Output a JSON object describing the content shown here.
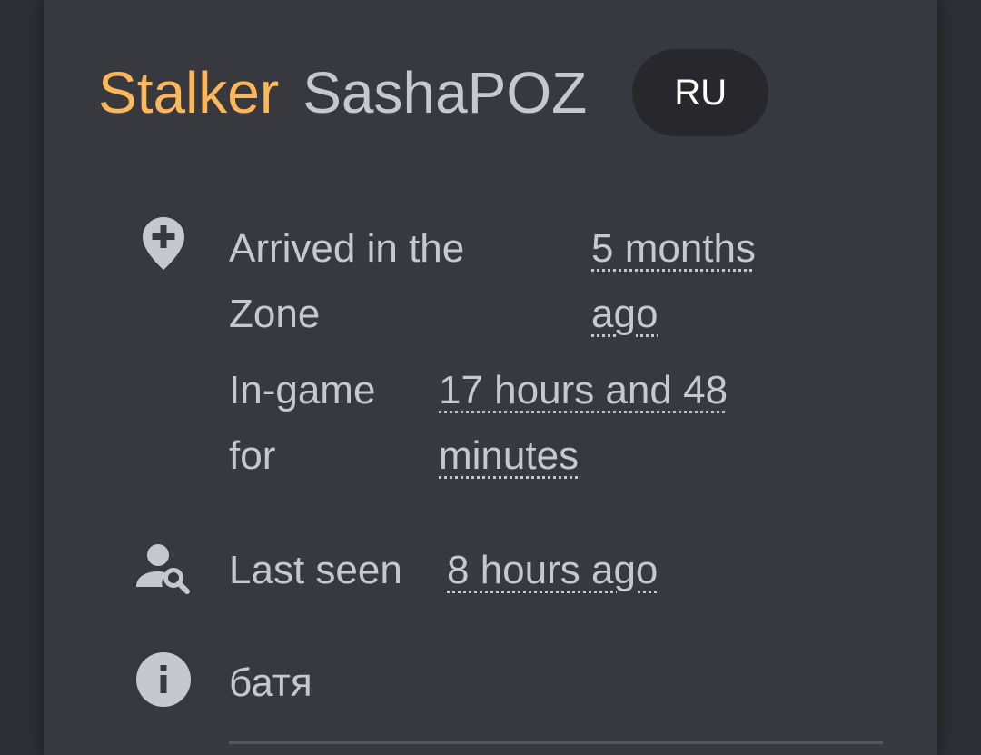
{
  "profile": {
    "rank": "Stalker",
    "username": "SashaPOZ",
    "language": "RU"
  },
  "details": {
    "arrived_label": "Arrived in the Zone",
    "arrived_value": "5 months ago",
    "ingame_label": "In-game for",
    "ingame_value": "17 hours and 48 minutes",
    "last_seen_label": "Last seen",
    "last_seen_value": "8 hours ago",
    "about": "батя"
  },
  "icons": {
    "arrived": "map-marker-plus-icon",
    "last_seen": "account-search-icon",
    "about": "information-icon"
  },
  "colors": {
    "rank": "#ffb759",
    "text": "#c7c8cd",
    "card": "#38393f",
    "badge": "#27272c"
  }
}
